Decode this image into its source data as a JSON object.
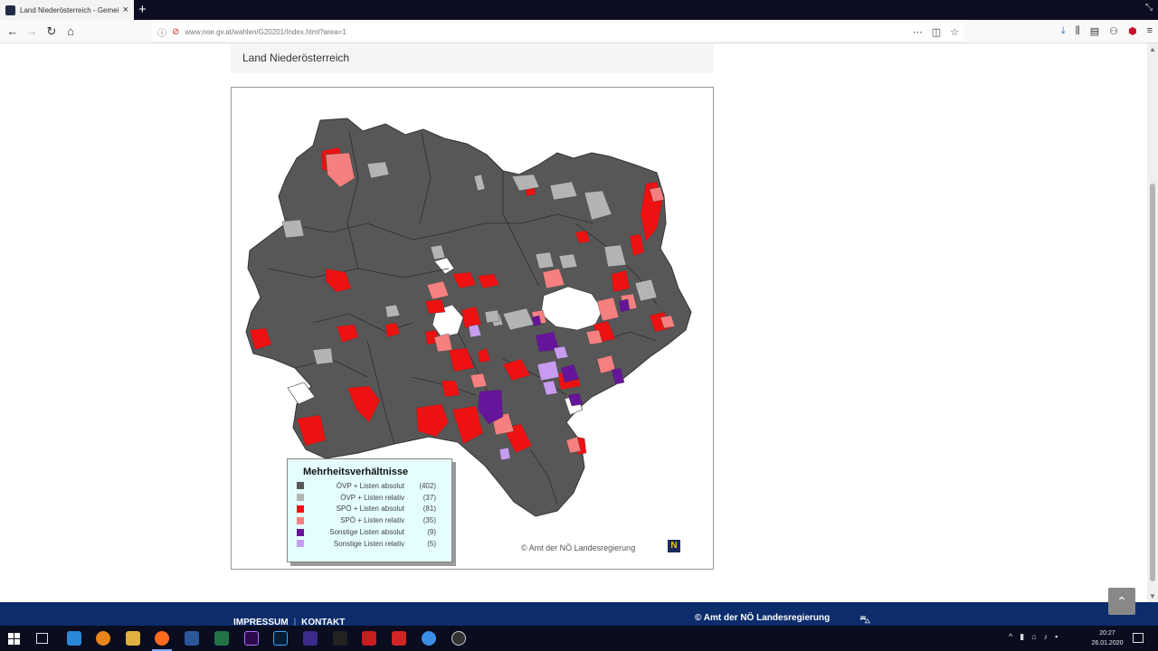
{
  "browser": {
    "tab_title": "Land Niederösterreich - Gemei",
    "url": "www.noe.gv.at/wahlen/G20201/Index.html?area=1"
  },
  "page": {
    "heading": "Land Niederösterreich"
  },
  "legend": {
    "title": "Mehrheitsverhältnisse",
    "items": [
      {
        "label": "ÖVP + Listen absolut",
        "count": "(402)",
        "color": "#585858"
      },
      {
        "label": "ÖVP + Listen relativ",
        "count": "(37)",
        "color": "#b4b4b4"
      },
      {
        "label": "SPÖ + Listen absolut",
        "count": "(81)",
        "color": "#ee1111"
      },
      {
        "label": "SPÖ + Listen relativ",
        "count": "(35)",
        "color": "#f58080"
      },
      {
        "label": "Sonstige Listen absolut",
        "count": "(9)",
        "color": "#66149a"
      },
      {
        "label": "Sonstige Listen relativ",
        "count": "(5)",
        "color": "#c79cf0"
      }
    ]
  },
  "map": {
    "copyright": "© Amt der NÖ Landesregierung",
    "logo_letter": "N"
  },
  "footer": {
    "impressum": "IMPRESSUM",
    "separator": "|",
    "kontakt": "KONTAKT",
    "copyright": "© Amt der NÖ Landesregierung"
  },
  "taskbar": {
    "time": "20:27",
    "date": "26.01.2020"
  }
}
